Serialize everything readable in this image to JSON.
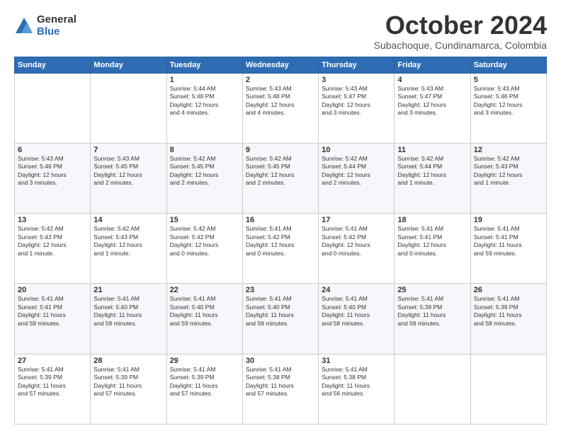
{
  "logo": {
    "general": "General",
    "blue": "Blue"
  },
  "title": "October 2024",
  "location": "Subachoque, Cundinamarca, Colombia",
  "weekdays": [
    "Sunday",
    "Monday",
    "Tuesday",
    "Wednesday",
    "Thursday",
    "Friday",
    "Saturday"
  ],
  "weeks": [
    [
      {
        "day": "",
        "info": ""
      },
      {
        "day": "",
        "info": ""
      },
      {
        "day": "1",
        "info": "Sunrise: 5:44 AM\nSunset: 5:48 PM\nDaylight: 12 hours\nand 4 minutes."
      },
      {
        "day": "2",
        "info": "Sunrise: 5:43 AM\nSunset: 5:48 PM\nDaylight: 12 hours\nand 4 minutes."
      },
      {
        "day": "3",
        "info": "Sunrise: 5:43 AM\nSunset: 5:47 PM\nDaylight: 12 hours\nand 3 minutes."
      },
      {
        "day": "4",
        "info": "Sunrise: 5:43 AM\nSunset: 5:47 PM\nDaylight: 12 hours\nand 3 minutes."
      },
      {
        "day": "5",
        "info": "Sunrise: 5:43 AM\nSunset: 5:46 PM\nDaylight: 12 hours\nand 3 minutes."
      }
    ],
    [
      {
        "day": "6",
        "info": "Sunrise: 5:43 AM\nSunset: 5:46 PM\nDaylight: 12 hours\nand 3 minutes."
      },
      {
        "day": "7",
        "info": "Sunrise: 5:43 AM\nSunset: 5:45 PM\nDaylight: 12 hours\nand 2 minutes."
      },
      {
        "day": "8",
        "info": "Sunrise: 5:42 AM\nSunset: 5:45 PM\nDaylight: 12 hours\nand 2 minutes."
      },
      {
        "day": "9",
        "info": "Sunrise: 5:42 AM\nSunset: 5:45 PM\nDaylight: 12 hours\nand 2 minutes."
      },
      {
        "day": "10",
        "info": "Sunrise: 5:42 AM\nSunset: 5:44 PM\nDaylight: 12 hours\nand 2 minutes."
      },
      {
        "day": "11",
        "info": "Sunrise: 5:42 AM\nSunset: 5:44 PM\nDaylight: 12 hours\nand 1 minute."
      },
      {
        "day": "12",
        "info": "Sunrise: 5:42 AM\nSunset: 5:43 PM\nDaylight: 12 hours\nand 1 minute."
      }
    ],
    [
      {
        "day": "13",
        "info": "Sunrise: 5:42 AM\nSunset: 5:43 PM\nDaylight: 12 hours\nand 1 minute."
      },
      {
        "day": "14",
        "info": "Sunrise: 5:42 AM\nSunset: 5:43 PM\nDaylight: 12 hours\nand 1 minute."
      },
      {
        "day": "15",
        "info": "Sunrise: 5:42 AM\nSunset: 5:42 PM\nDaylight: 12 hours\nand 0 minutes."
      },
      {
        "day": "16",
        "info": "Sunrise: 5:41 AM\nSunset: 5:42 PM\nDaylight: 12 hours\nand 0 minutes."
      },
      {
        "day": "17",
        "info": "Sunrise: 5:41 AM\nSunset: 5:42 PM\nDaylight: 12 hours\nand 0 minutes."
      },
      {
        "day": "18",
        "info": "Sunrise: 5:41 AM\nSunset: 5:41 PM\nDaylight: 12 hours\nand 0 minutes."
      },
      {
        "day": "19",
        "info": "Sunrise: 5:41 AM\nSunset: 5:41 PM\nDaylight: 11 hours\nand 59 minutes."
      }
    ],
    [
      {
        "day": "20",
        "info": "Sunrise: 5:41 AM\nSunset: 5:41 PM\nDaylight: 11 hours\nand 59 minutes."
      },
      {
        "day": "21",
        "info": "Sunrise: 5:41 AM\nSunset: 5:40 PM\nDaylight: 11 hours\nand 59 minutes."
      },
      {
        "day": "22",
        "info": "Sunrise: 5:41 AM\nSunset: 5:40 PM\nDaylight: 11 hours\nand 59 minutes."
      },
      {
        "day": "23",
        "info": "Sunrise: 5:41 AM\nSunset: 5:40 PM\nDaylight: 11 hours\nand 58 minutes."
      },
      {
        "day": "24",
        "info": "Sunrise: 5:41 AM\nSunset: 5:40 PM\nDaylight: 11 hours\nand 58 minutes."
      },
      {
        "day": "25",
        "info": "Sunrise: 5:41 AM\nSunset: 5:39 PM\nDaylight: 11 hours\nand 58 minutes."
      },
      {
        "day": "26",
        "info": "Sunrise: 5:41 AM\nSunset: 5:39 PM\nDaylight: 11 hours\nand 58 minutes."
      }
    ],
    [
      {
        "day": "27",
        "info": "Sunrise: 5:41 AM\nSunset: 5:39 PM\nDaylight: 11 hours\nand 57 minutes."
      },
      {
        "day": "28",
        "info": "Sunrise: 5:41 AM\nSunset: 5:39 PM\nDaylight: 11 hours\nand 57 minutes."
      },
      {
        "day": "29",
        "info": "Sunrise: 5:41 AM\nSunset: 5:39 PM\nDaylight: 11 hours\nand 57 minutes."
      },
      {
        "day": "30",
        "info": "Sunrise: 5:41 AM\nSunset: 5:38 PM\nDaylight: 11 hours\nand 57 minutes."
      },
      {
        "day": "31",
        "info": "Sunrise: 5:41 AM\nSunset: 5:38 PM\nDaylight: 11 hours\nand 56 minutes."
      },
      {
        "day": "",
        "info": ""
      },
      {
        "day": "",
        "info": ""
      }
    ]
  ]
}
